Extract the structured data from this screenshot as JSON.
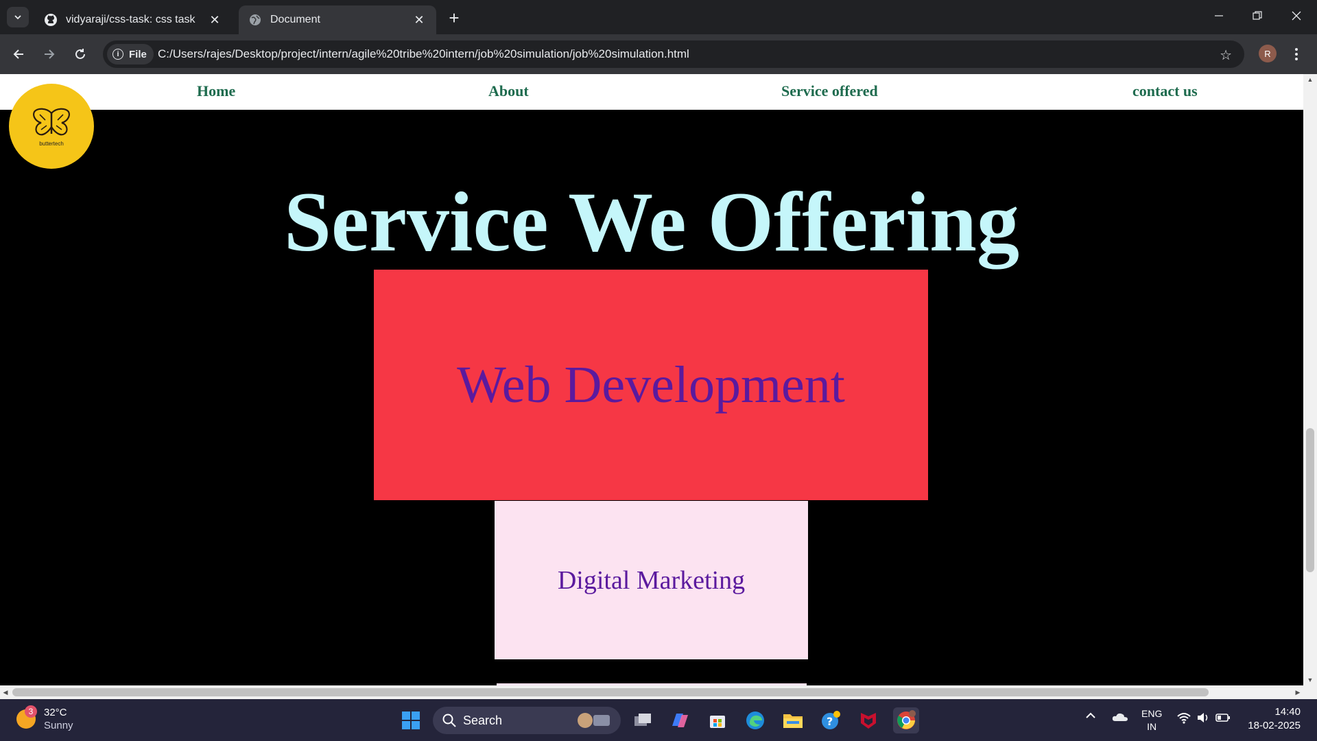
{
  "browser": {
    "tabs": [
      {
        "title": "vidyaraji/css-task: css task",
        "favicon": "github-icon",
        "active": false
      },
      {
        "title": "Document",
        "favicon": "globe-icon",
        "active": true
      }
    ],
    "omnibox": {
      "chip_label": "File",
      "url": "C:/Users/rajes/Desktop/project/intern/agile%20tribe%20intern/job%20simulation/job%20simulation.html"
    },
    "profile_initial": "R"
  },
  "page": {
    "nav": {
      "links": [
        "Home",
        "About",
        "Service offered",
        "contact us"
      ]
    },
    "logo": {
      "text": "buttertech",
      "icon": "butterfly-icon"
    },
    "heading": "Service We Offering",
    "services": [
      {
        "label": "Web Development",
        "color": "#f63745"
      },
      {
        "label": "Digital Marketing",
        "color": "#fce3f1"
      }
    ],
    "colors": {
      "heading": "#c5f6fa",
      "nav_link": "#1e6b4e",
      "card_text": "#5b1a9e",
      "logo_bg": "#f5c518"
    }
  },
  "taskbar": {
    "weather": {
      "temp": "32°C",
      "condition": "Sunny",
      "badge": "3"
    },
    "search_label": "Search",
    "language": {
      "line1": "ENG",
      "line2": "IN"
    },
    "clock": {
      "time": "14:40",
      "date": "18-02-2025"
    }
  }
}
